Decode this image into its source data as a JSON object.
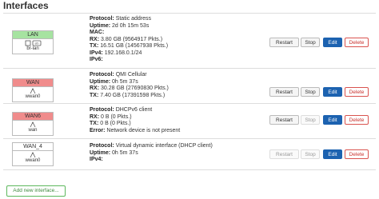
{
  "page": {
    "title": "Interfaces",
    "add_button": "Add new interface..."
  },
  "colors": {
    "lan": "#a6e3a1",
    "wan": "#f08c8c",
    "edit": "#1c62b0",
    "add": "#5cb85c"
  },
  "buttons": {
    "restart": "Restart",
    "stop": "Stop",
    "edit": "Edit",
    "delete": "Delete"
  },
  "interfaces": [
    {
      "name": "LAN",
      "device": "br-lan",
      "icon_label": "(eth)",
      "lines": [
        {
          "label": "Protocol:",
          "value": "Static address"
        },
        {
          "label": "Uptime:",
          "value": "2d 0h 15m 53s"
        },
        {
          "label": "MAC:",
          "value": ""
        },
        {
          "label": "RX:",
          "value": "3.80 GB (9564917 Pkts.)"
        },
        {
          "label": "TX:",
          "value": "16.51 GB (14567938 Pkts.)"
        },
        {
          "label": "IPv4:",
          "value": "192.168.0.1/24"
        },
        {
          "label": "IPv6:",
          "value": ""
        }
      ]
    },
    {
      "name": "WAN",
      "device": "wwan0",
      "lines": [
        {
          "label": "Protocol:",
          "value": "QMI Cellular"
        },
        {
          "label": "Uptime:",
          "value": "0h 5m 37s"
        },
        {
          "label": "RX:",
          "value": "30.28 GB (27690830 Pkts.)"
        },
        {
          "label": "TX:",
          "value": "7.40 GB (17391598 Pkts.)"
        }
      ]
    },
    {
      "name": "WAN6",
      "device": "wan",
      "lines": [
        {
          "label": "Protocol:",
          "value": "DHCPv6 client"
        },
        {
          "label": "RX:",
          "value": "0 B (0 Pkts.)"
        },
        {
          "label": "TX:",
          "value": "0 B (0 Pkts.)"
        },
        {
          "label": "Error:",
          "value": "Network device is not present"
        }
      ]
    },
    {
      "name": "WAN_4",
      "device": "wwan0",
      "lines": [
        {
          "label": "Protocol:",
          "value": "Virtual dynamic interface (DHCP client)"
        },
        {
          "label": "Uptime:",
          "value": "0h 5m 37s"
        },
        {
          "label": "IPv4:",
          "value": ""
        }
      ]
    }
  ]
}
